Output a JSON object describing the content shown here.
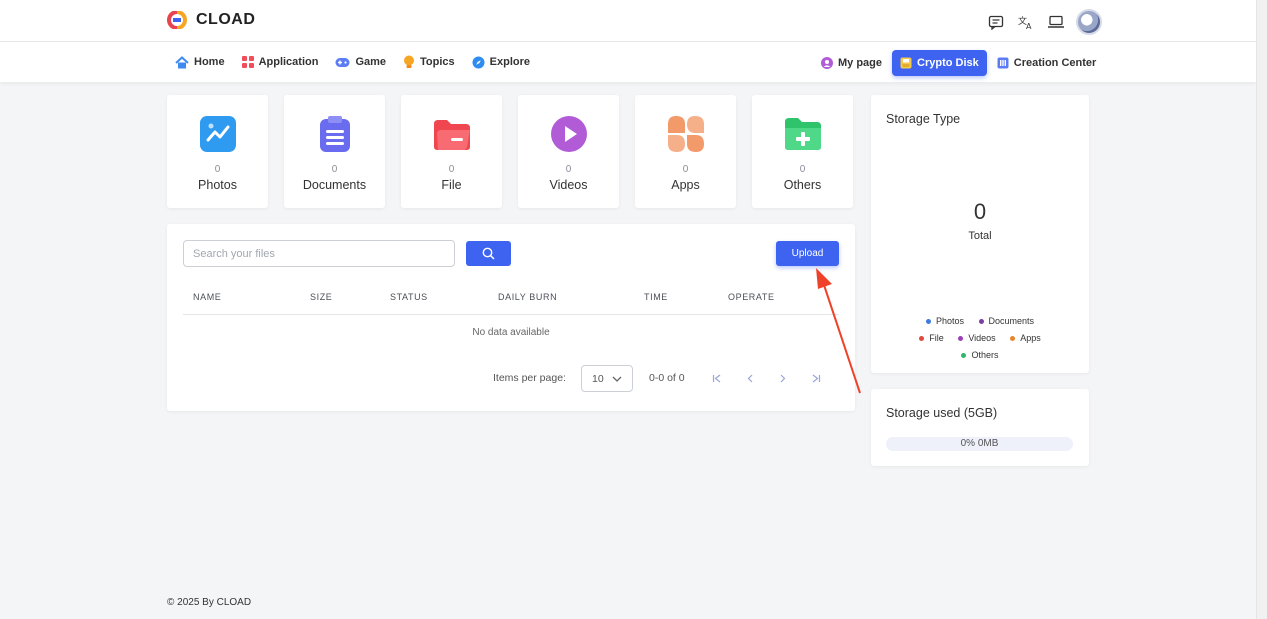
{
  "app": {
    "name": "CLOAD"
  },
  "nav": {
    "left": [
      {
        "label": "Home",
        "icon": "home-icon",
        "color": "#3d8bf0"
      },
      {
        "label": "Application",
        "icon": "apps-grid-icon",
        "color": "#f04e5a"
      },
      {
        "label": "Game",
        "icon": "gamepad-icon",
        "color": "#5b7cf5"
      },
      {
        "label": "Topics",
        "icon": "lightbulb-icon",
        "color": "#f5a623"
      },
      {
        "label": "Explore",
        "icon": "compass-icon",
        "color": "#2f8cf0"
      }
    ],
    "right": [
      {
        "label": "My page",
        "icon": "user-circle-icon",
        "color": "#b25bd6"
      },
      {
        "label": "Crypto Disk",
        "icon": "disk-icon",
        "color": "#f5c94a",
        "active": true
      },
      {
        "label": "Creation Center",
        "icon": "creation-icon",
        "color": "#5b7cf5"
      }
    ]
  },
  "categories": [
    {
      "name": "Photos",
      "count": "0",
      "color": "#2f9bf0",
      "icon": "photo-chart-icon"
    },
    {
      "name": "Documents",
      "count": "0",
      "color": "#6a6cf0",
      "icon": "clipboard-icon"
    },
    {
      "name": "File",
      "count": "0",
      "color": "#f0464f",
      "icon": "folder-icon"
    },
    {
      "name": "Videos",
      "count": "0",
      "color": "#b25bd6",
      "icon": "play-icon"
    },
    {
      "name": "Apps",
      "count": "0",
      "color": "#f29a6a",
      "icon": "apps-icon"
    },
    {
      "name": "Others",
      "count": "0",
      "color": "#2fc46b",
      "icon": "folder-plus-icon"
    }
  ],
  "files": {
    "search_placeholder": "Search your files",
    "upload_label": "Upload",
    "columns": [
      "NAME",
      "SIZE",
      "STATUS",
      "DAILY BURN",
      "TIME",
      "OPERATE"
    ],
    "empty_text": "No data available",
    "items_per_page_label": "Items per page:",
    "items_per_page": "10",
    "range_text": "0-0 of 0"
  },
  "storage_type": {
    "title": "Storage Type",
    "total": "0",
    "total_label": "Total",
    "legend": [
      {
        "label": "Photos",
        "color": "#3d7be0"
      },
      {
        "label": "Documents",
        "color": "#7b3fa0"
      },
      {
        "label": "File",
        "color": "#e04a3a"
      },
      {
        "label": "Videos",
        "color": "#9b40b8"
      },
      {
        "label": "Apps",
        "color": "#e8862a"
      },
      {
        "label": "Others",
        "color": "#2fb86b"
      }
    ]
  },
  "storage_used": {
    "title": "Storage used (5GB)",
    "percent": 0,
    "text": "0% 0MB"
  },
  "footer": {
    "text": "© 2025 By CLOAD"
  },
  "colors": {
    "accent": "#3d63f0",
    "background": "#f4f5f7",
    "annotation_arrow": "#f0412a"
  }
}
